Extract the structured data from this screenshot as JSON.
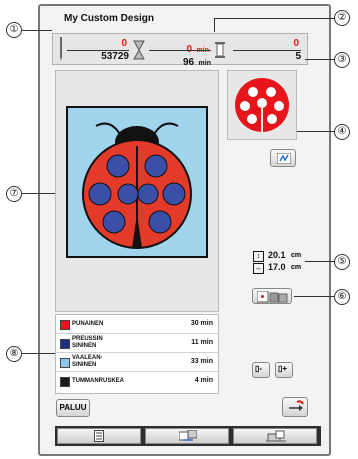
{
  "title": "My Custom Design",
  "counters": {
    "stitch_current": "0",
    "stitch_total": "53729",
    "time_current": "0",
    "time_total": "96",
    "time_unit": "min",
    "color_current": "0",
    "color_total": "5"
  },
  "dimensions": {
    "height": "20.1",
    "width": "17.0",
    "unit": "cm"
  },
  "threads": [
    {
      "name": "PUNAINEN",
      "time": "30 min",
      "color": "#e8141c"
    },
    {
      "name": "PREUSSIN\nSININEN",
      "time": "11 min",
      "color": "#1d2f8a"
    },
    {
      "name": "VAALEAN-\nSININEN",
      "time": "33 min",
      "color": "#8cc8e8"
    },
    {
      "name": "TUMMANRUSKEA",
      "time": "4 min",
      "color": "#1a1a1a"
    }
  ],
  "buttons": {
    "back": "PALUU"
  },
  "callouts": [
    "①",
    "②",
    "③",
    "④",
    "⑤",
    "⑥",
    "⑦",
    "⑧"
  ],
  "colors": {
    "accent_red": "#e21a1a",
    "ladybug_red": "#e43a2a",
    "ladybug_spots": "#3b4ea8",
    "design_bg": "#9fd4ec"
  }
}
